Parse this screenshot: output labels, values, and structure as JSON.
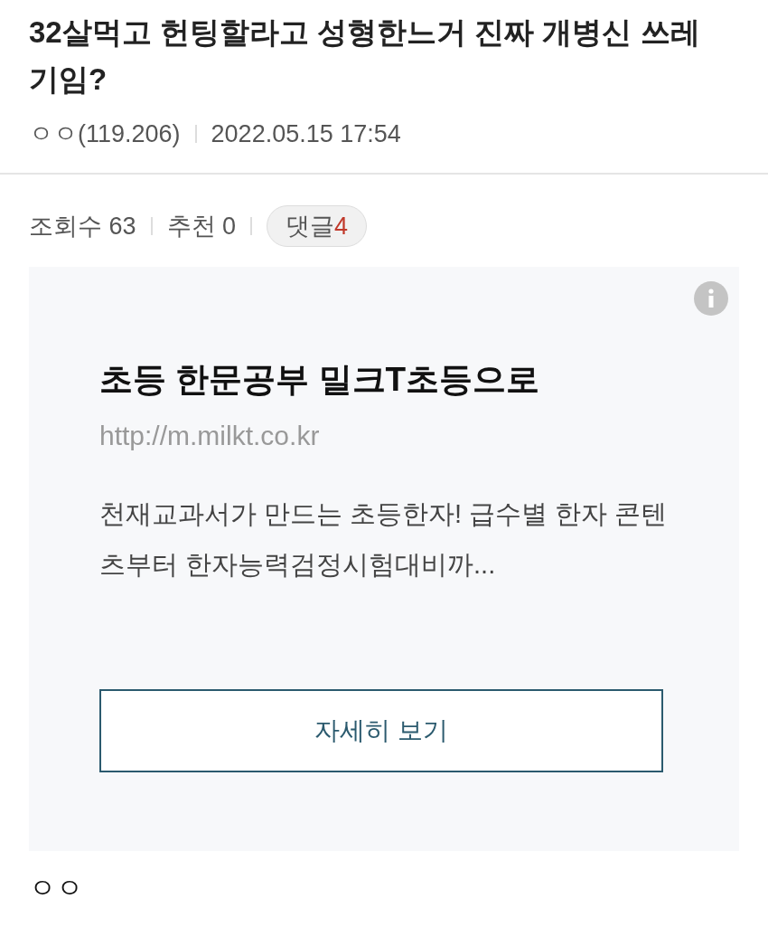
{
  "post": {
    "title": "32살먹고 헌팅할라고 성형한느거 진짜 개병신 쓰레기임?",
    "author": "ㅇㅇ(119.206)",
    "date": "2022.05.15 17:54"
  },
  "stats": [
    {
      "kind": "text",
      "label": "조회수 63"
    },
    {
      "kind": "text",
      "label": "추천 0"
    },
    {
      "kind": "pill",
      "label": "댓글",
      "count": "4"
    }
  ],
  "ad": {
    "title": "초등 한문공부 밀크T초등으로",
    "url": "http://m.milkt.co.kr",
    "description": "천재교과서가 만드는 초등한자! 급수별 한자 콘텐츠부터 한자능력검정시험대비까...",
    "button": "자세히 보기"
  },
  "body": "ㅇㅇ"
}
